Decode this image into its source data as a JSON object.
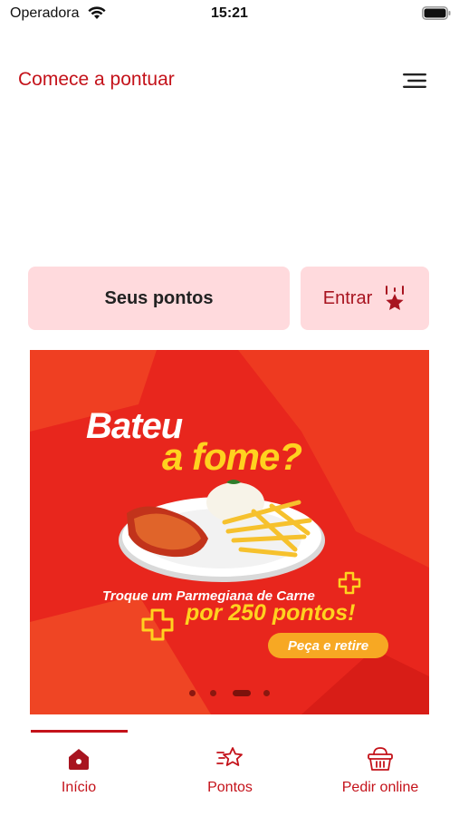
{
  "status_bar": {
    "carrier": "Operadora",
    "time": "15:21"
  },
  "header": {
    "title": "Comece a pontuar",
    "menu_icon": "menu-icon"
  },
  "actions": {
    "points_label": "Seus pontos",
    "login_label": "Entrar",
    "login_icon": "badge-star-icon"
  },
  "banner": {
    "title_line1": "Bateu",
    "title_line2": "a fome?",
    "offer_line1": "Troque um Parmegiana de Carne",
    "offer_line2": "por 250 pontos!",
    "cta": "Peça e retire",
    "carousel": {
      "total": 4,
      "active_index": 2
    }
  },
  "tabs": [
    {
      "label": "Início",
      "icon": "home-icon",
      "active": true
    },
    {
      "label": "Pontos",
      "icon": "points-star-icon",
      "active": false
    },
    {
      "label": "Pedir online",
      "icon": "basket-icon",
      "active": false
    }
  ],
  "colors": {
    "brand_red": "#c4121a",
    "button_bg": "#ffdadd",
    "banner_red": "#e8261d",
    "banner_yellow": "#ffd21f"
  }
}
